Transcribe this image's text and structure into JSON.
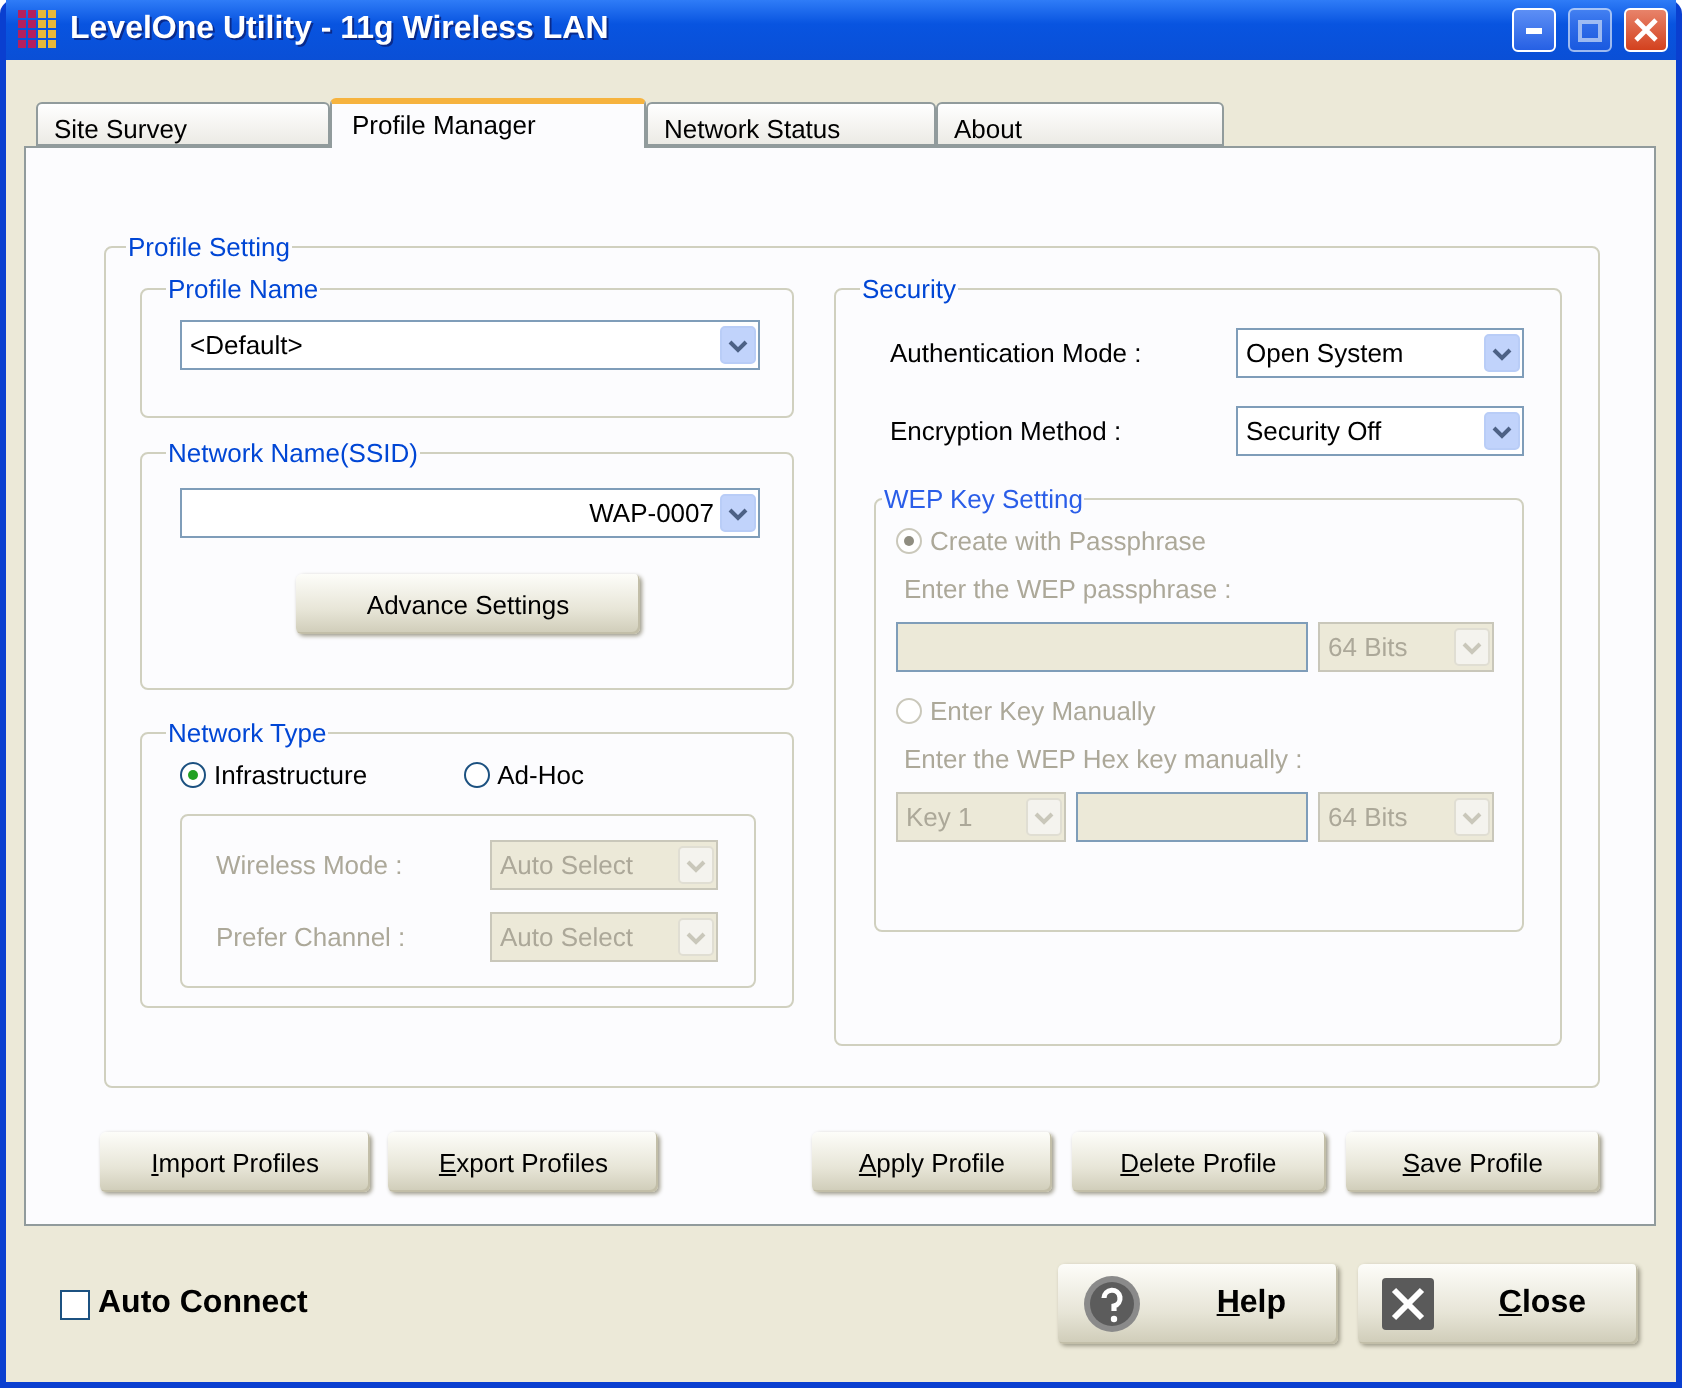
{
  "window": {
    "title": "LevelOne Utility - 11g Wireless LAN"
  },
  "tabs": [
    {
      "label": "Site Survey",
      "selected": false
    },
    {
      "label": "Profile Manager",
      "selected": true
    },
    {
      "label": "Network Status",
      "selected": false
    },
    {
      "label": "About",
      "selected": false
    }
  ],
  "profile_setting": {
    "title": "Profile Setting",
    "profile_name": {
      "title": "Profile Name",
      "value": "<Default>"
    },
    "network_name": {
      "title": "Network Name(SSID)",
      "value": "WAP-0007",
      "button": "Advance Settings"
    },
    "network_type": {
      "title": "Network Type",
      "options": [
        {
          "label": "Infrastructure",
          "selected": true
        },
        {
          "label": "Ad-Hoc",
          "selected": false
        }
      ],
      "fields": [
        {
          "label": "Wireless Mode :",
          "value": "Auto Select",
          "disabled": true
        },
        {
          "label": "Prefer Channel :",
          "value": "Auto Select",
          "disabled": true
        }
      ]
    },
    "security": {
      "title": "Security",
      "fields": [
        {
          "label": "Authentication Mode :",
          "value": "Open System",
          "disabled": false
        },
        {
          "label": "Encryption Method :",
          "value": "Security Off",
          "disabled": false
        }
      ],
      "wep": {
        "title": "WEP Key Setting",
        "disabled": true,
        "options": [
          {
            "label": "Create with Passphrase",
            "selected": true,
            "hint": "Enter the WEP passphrase :",
            "bits": "64 Bits"
          },
          {
            "label": "Enter Key Manually",
            "selected": false,
            "hint": "Enter the WEP Hex key manually :",
            "key": "Key 1",
            "bits": "64 Bits"
          }
        ]
      }
    }
  },
  "profile_buttons": [
    {
      "label": "Import Profiles"
    },
    {
      "label": "Export Profiles"
    },
    {
      "label": "Apply Profile"
    },
    {
      "label": "Delete Profile"
    },
    {
      "label": "Save Profile"
    }
  ],
  "auto_connect": {
    "label": "Auto Connect",
    "checked": false
  },
  "footer_buttons": [
    {
      "label": "Help",
      "kind": "help"
    },
    {
      "label": "Close",
      "kind": "close"
    }
  ]
}
